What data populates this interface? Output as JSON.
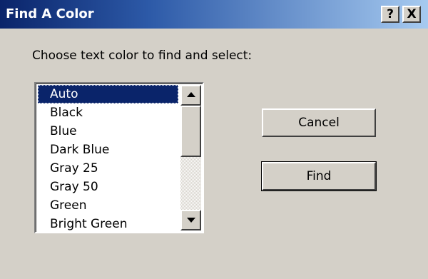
{
  "window": {
    "title": "Find A Color",
    "help_label": "?",
    "close_label": "X"
  },
  "prompt": "Choose text color to find and select:",
  "color_list": {
    "selected": "Auto",
    "items": [
      "Auto",
      "Black",
      "Blue",
      "Dark Blue",
      "Gray 25",
      "Gray 50",
      "Green",
      "Bright Green"
    ]
  },
  "buttons": {
    "cancel_label": "Cancel",
    "find_label": "Find"
  },
  "colors": {
    "selection": "#0a246a",
    "dialog_bg": "#d4d0c8"
  }
}
